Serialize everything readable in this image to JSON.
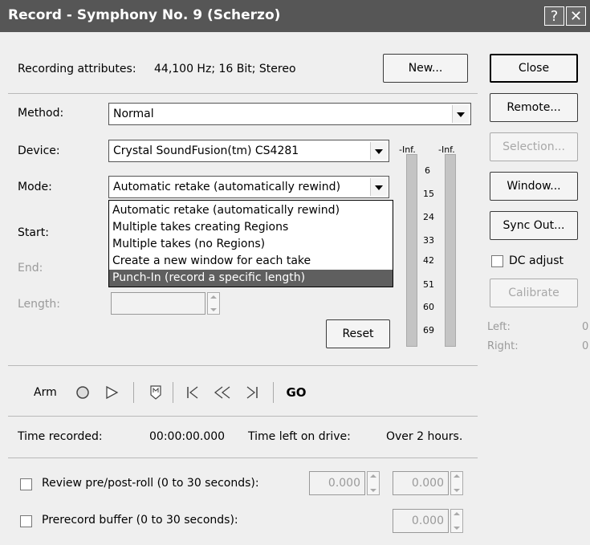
{
  "window": {
    "title": "Record - Symphony No. 9 (Scherzo)",
    "help_label": "?",
    "close_label": "✕"
  },
  "attributes": {
    "label": "Recording attributes:",
    "value": "44,100 Hz; 16 Bit; Stereo"
  },
  "buttons": {
    "new": "New...",
    "close": "Close",
    "remote": "Remote...",
    "selection": "Selection...",
    "window": "Window...",
    "sync_out": "Sync Out...",
    "calibrate": "Calibrate",
    "reset": "Reset"
  },
  "method": {
    "label": "Method:",
    "value": "Normal"
  },
  "device": {
    "label": "Device:",
    "value": "Crystal SoundFusion(tm) CS4281"
  },
  "mode": {
    "label": "Mode:",
    "value": "Automatic retake (automatically rewind)",
    "options": [
      "Automatic retake (automatically rewind)",
      "Multiple takes creating Regions",
      "Multiple takes (no Regions)",
      "Create a new window for each take",
      "Punch-In (record a specific length)"
    ],
    "highlighted_index": 4
  },
  "start": {
    "label": "Start:"
  },
  "end": {
    "label": "End:"
  },
  "length": {
    "label": "Length:"
  },
  "meters": {
    "left_label": "-Inf.",
    "right_label": "-Inf.",
    "ticks": [
      "6",
      "15",
      "24",
      "33",
      "42",
      "51",
      "60",
      "69"
    ]
  },
  "dc_adjust": {
    "label": "DC adjust",
    "checked": false
  },
  "levels": {
    "left_label": "Left:",
    "left_value": "0",
    "right_label": "Right:",
    "right_value": "0"
  },
  "transport": {
    "arm_label": "Arm",
    "go_label": "GO"
  },
  "status": {
    "time_recorded_label": "Time recorded:",
    "time_recorded_value": "00:00:00.000",
    "time_left_label": "Time left on drive:",
    "time_left_value": "Over 2 hours."
  },
  "review": {
    "label": "Review pre/post-roll (0 to 30 seconds):",
    "pre_value": "0.000",
    "post_value": "0.000",
    "checked": false
  },
  "prerecord": {
    "label": "Prerecord buffer (0 to 30 seconds):",
    "value": "0.000",
    "checked": false
  }
}
